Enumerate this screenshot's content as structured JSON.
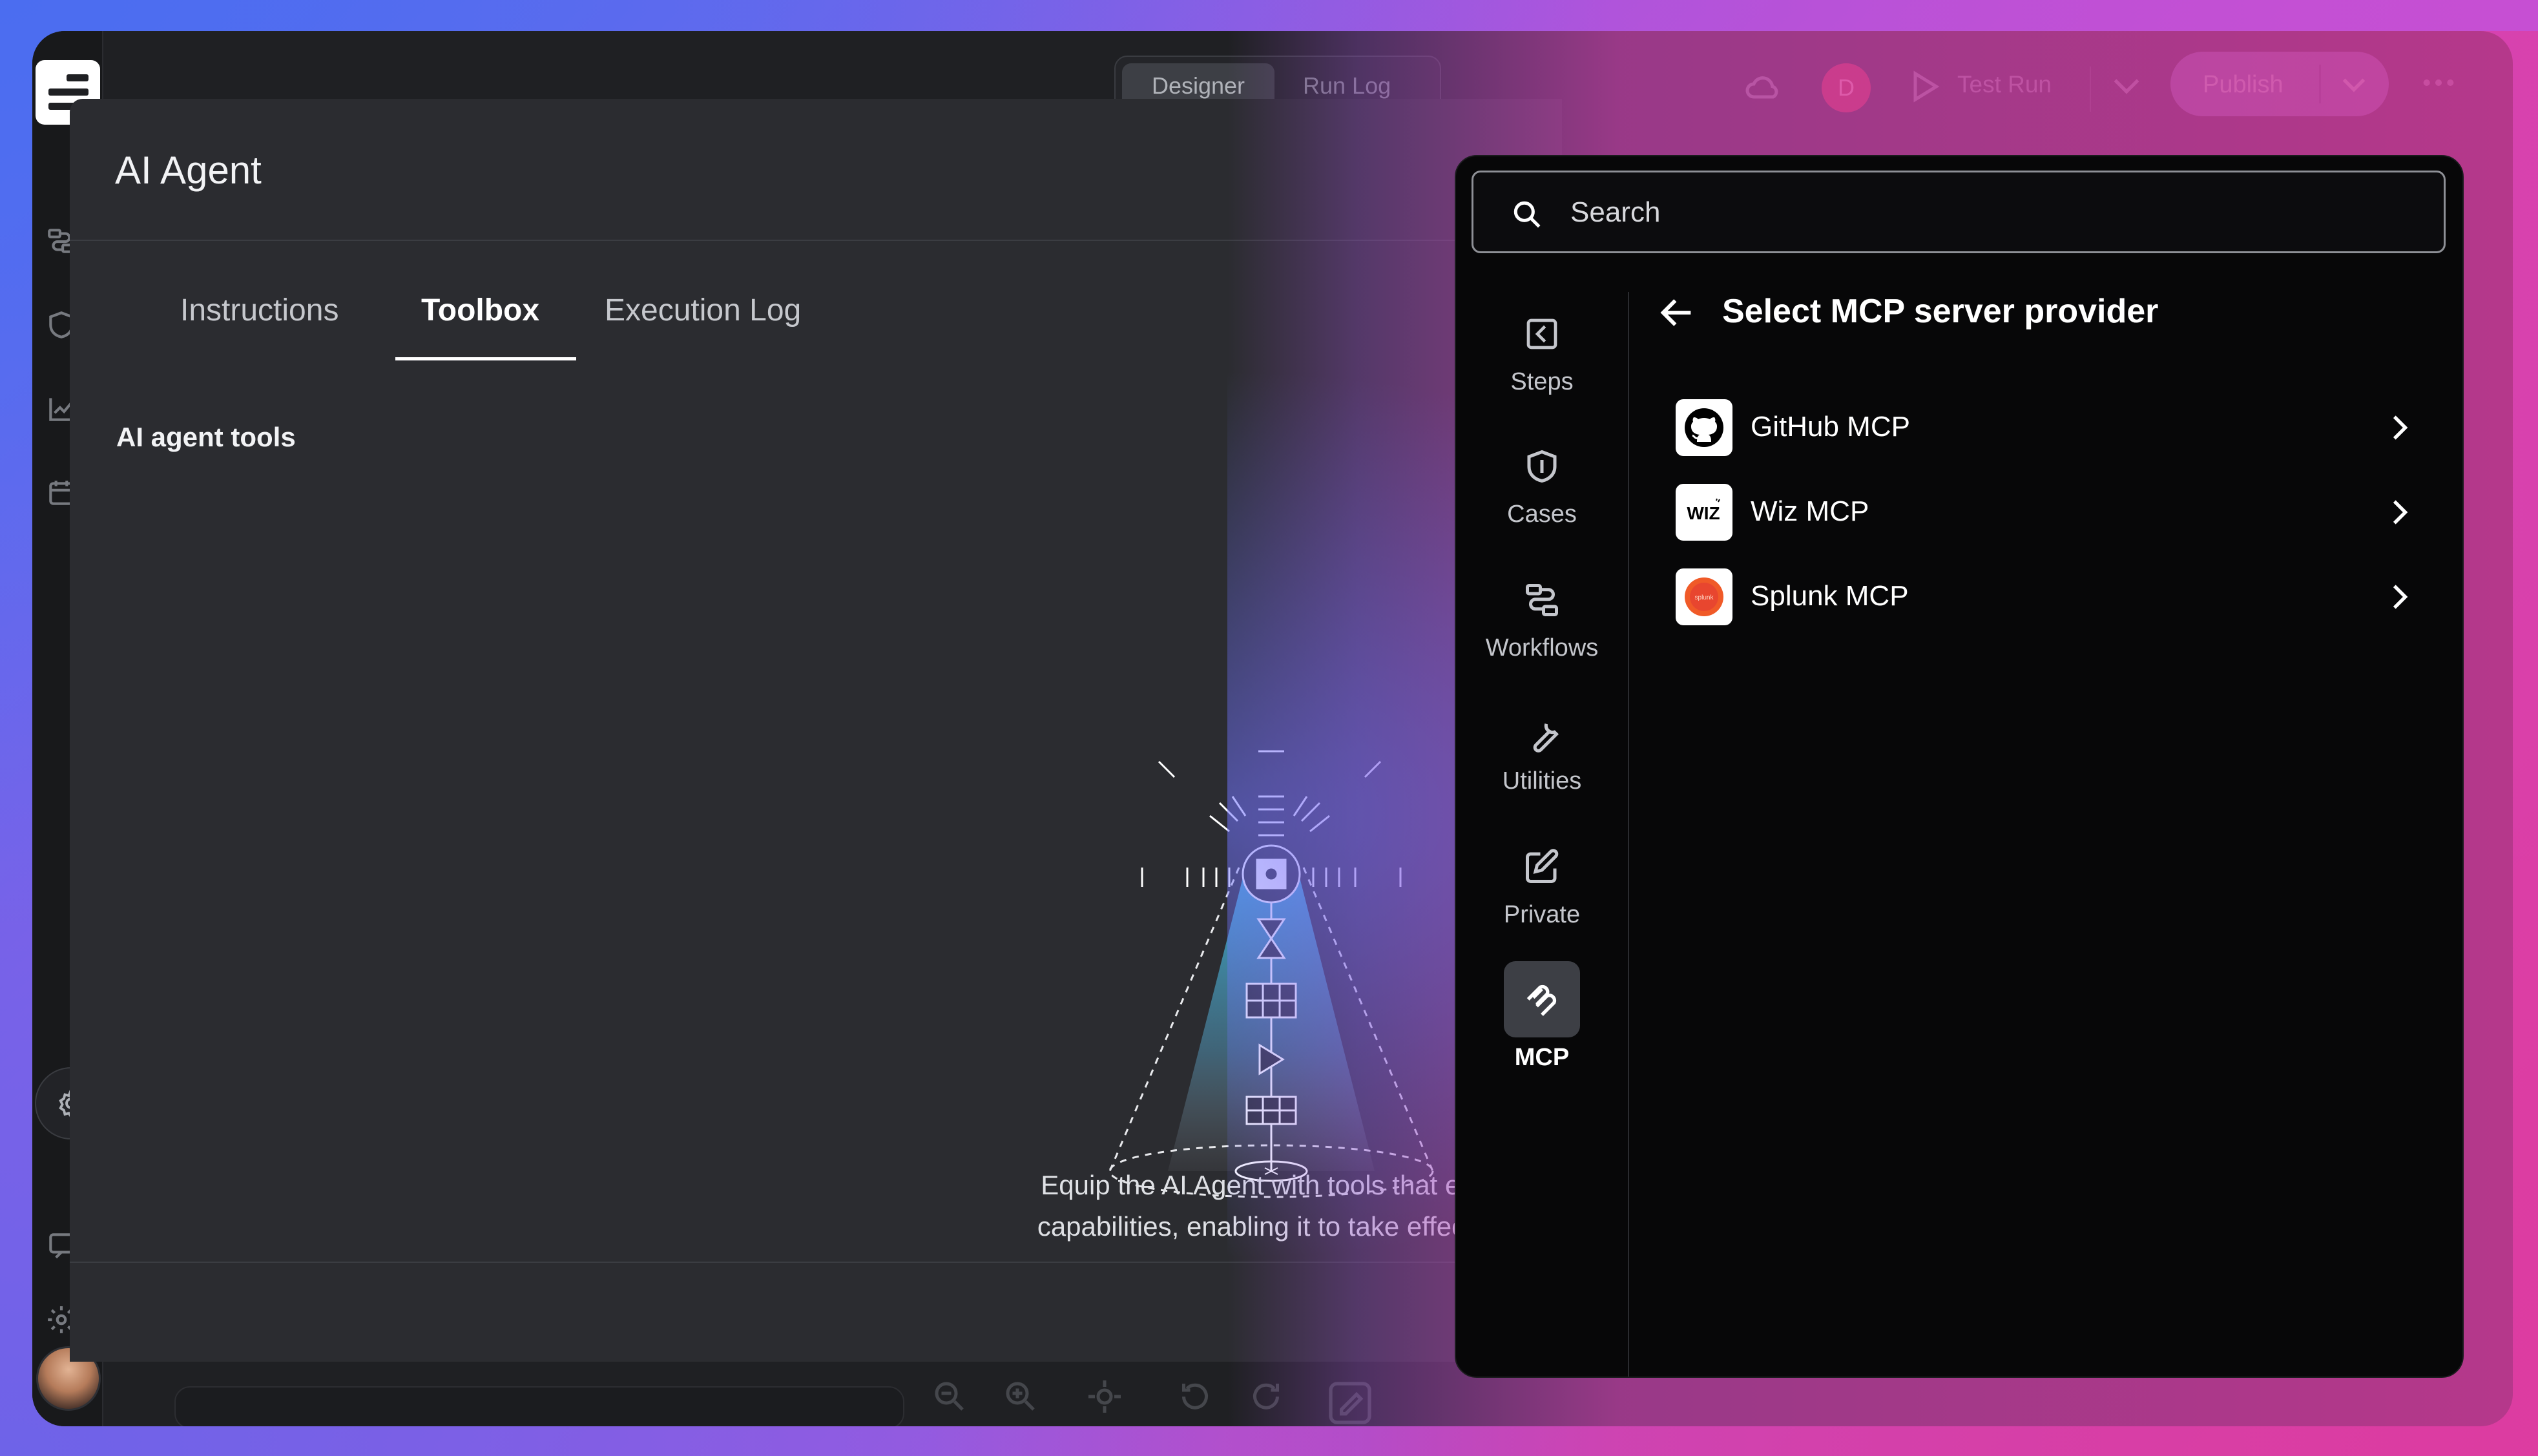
{
  "topbar": {
    "mode_tabs": [
      "Designer",
      "Run Log"
    ],
    "user_initial": "D",
    "test_run_label": "Test Run",
    "publish_label": "Publish"
  },
  "agent": {
    "title": "AI Agent",
    "tabs": [
      {
        "label": "Instructions",
        "active": false
      },
      {
        "label": "Toolbox",
        "active": true
      },
      {
        "label": "Execution Log",
        "active": false
      }
    ],
    "section_title": "AI agent tools",
    "description_line1": "Equip the AI Agent with tools that exp",
    "description_line2": "capabilities, enabling it to take effectiv"
  },
  "picker": {
    "search_placeholder": "Search",
    "categories": [
      {
        "label": "Steps",
        "icon": "steps-icon"
      },
      {
        "label": "Cases",
        "icon": "shield-icon"
      },
      {
        "label": "Workflows",
        "icon": "workflow-icon"
      },
      {
        "label": "Utilities",
        "icon": "wrench-icon"
      },
      {
        "label": "Private",
        "icon": "edit-icon"
      },
      {
        "label": "MCP",
        "icon": "mcp-icon",
        "active": true
      }
    ],
    "panel_title": "Select MCP server provider",
    "providers": [
      {
        "name": "GitHub MCP",
        "logo": "github-logo"
      },
      {
        "name": "Wiz MCP",
        "logo": "wiz-logo",
        "logo_text": "WIZ"
      },
      {
        "name": "Splunk MCP",
        "logo": "splunk-logo",
        "logo_text": "splunk"
      }
    ]
  },
  "colors": {
    "accent_gradient_start": "#5a6ff0",
    "accent_gradient_end": "#e23f9d",
    "panel_bg": "#2b2c30",
    "picker_bg": "#070708",
    "splunk_orange": "#f05a28"
  }
}
